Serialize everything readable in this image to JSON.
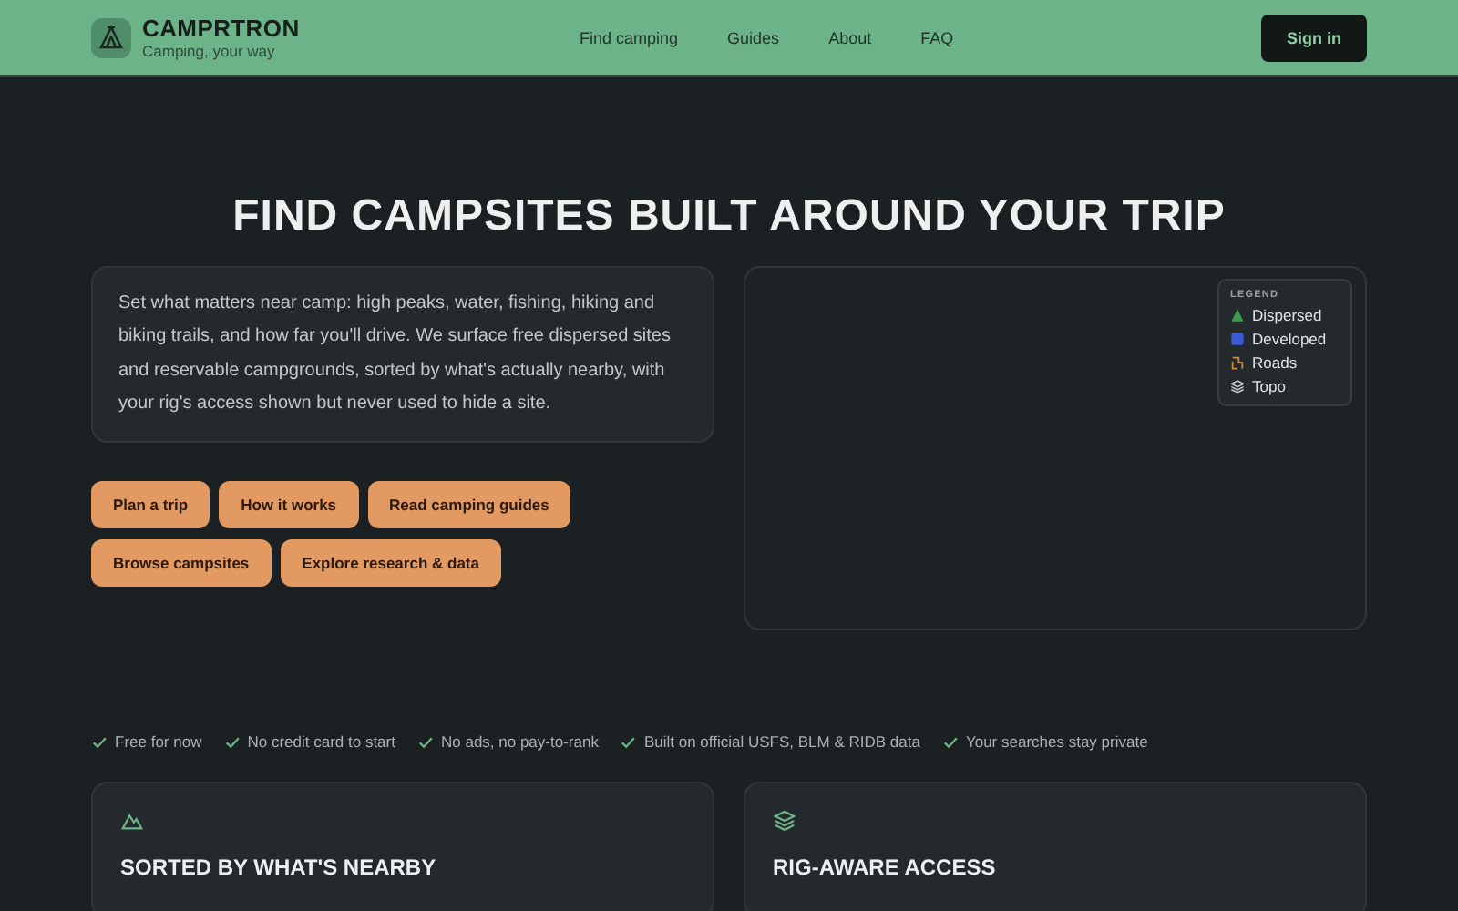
{
  "header": {
    "brand": "CAMPRTRON",
    "tagline": "Camping, your way",
    "nav": [
      "Find camping",
      "Guides",
      "About",
      "FAQ"
    ],
    "sign_in": "Sign in"
  },
  "hero": {
    "title": "FIND CAMPSITES BUILT AROUND YOUR TRIP",
    "intro": "Set what matters near camp: high peaks, water, fishing, hiking and biking trails, and how far you'll drive. We surface free dispersed sites and reservable campgrounds, sorted by what's actually nearby, with your rig's access shown but never used to hide a site.",
    "actions": [
      "Plan a trip",
      "How it works",
      "Read camping guides",
      "Browse campsites",
      "Explore research & data"
    ]
  },
  "map": {
    "legend_title": "LEGEND",
    "legend": [
      {
        "kind": "dispersed",
        "label": "Dispersed",
        "color": "#3f9a52"
      },
      {
        "kind": "developed",
        "label": "Developed",
        "color": "#3b5bd6"
      },
      {
        "kind": "roads",
        "label": "Roads",
        "color": "#c9893d"
      },
      {
        "kind": "topo",
        "label": "Topo",
        "color": "#c7ccd1"
      }
    ]
  },
  "perks": [
    "Free for now",
    "No credit card to start",
    "No ads, no pay-to-rank",
    "Built on official USFS, BLM & RIDB data",
    "Your searches stay private"
  ],
  "features": [
    {
      "kind": "mountain",
      "title": "SORTED BY WHAT'S NEARBY"
    },
    {
      "kind": "layers",
      "title": "RIG-AWARE ACCESS"
    }
  ]
}
